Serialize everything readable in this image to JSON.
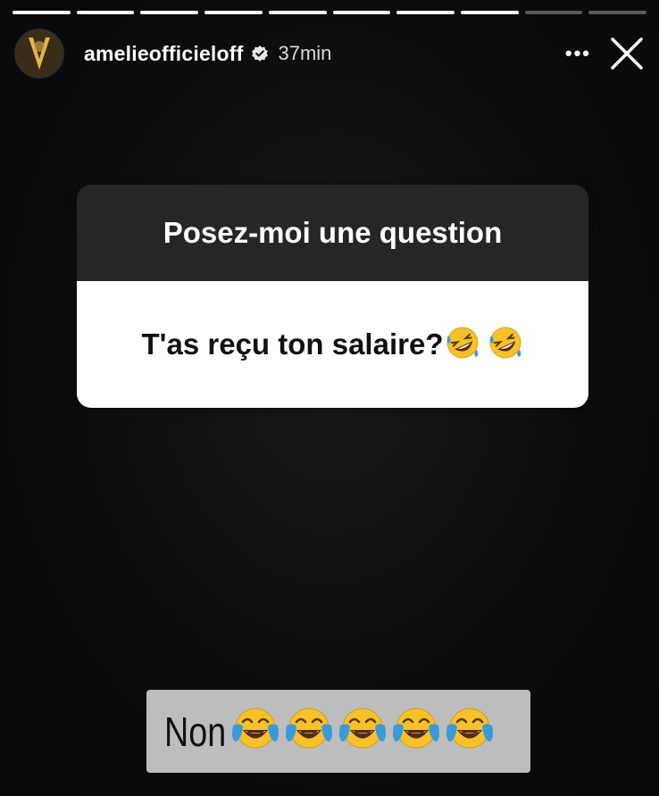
{
  "story": {
    "progress": {
      "segments_total": 10,
      "segments_viewed": 8
    },
    "header": {
      "username": "amelieofficieloff",
      "time": "37min",
      "verified_icon": "verified-badge-icon",
      "more_label": "•••",
      "close_icon": "close-icon"
    },
    "question_sticker": {
      "title": "Posez-moi une question",
      "question": "T'as reçu ton salaire?",
      "question_emojis": [
        "rolling-on-floor-laughing-emoji",
        "rolling-on-floor-laughing-emoji"
      ]
    },
    "answer": {
      "text": "Non",
      "emojis": [
        "tears-of-joy-emoji",
        "tears-of-joy-emoji",
        "tears-of-joy-emoji",
        "tears-of-joy-emoji",
        "tears-of-joy-emoji"
      ]
    },
    "colors": {
      "background": "#0b0b0b",
      "card_header": "#262626",
      "card_body": "#ffffff",
      "answer_bg": "#bdbdbd",
      "emoji_yellow": "#f6c12b",
      "emoji_tear": "#3a9ad9"
    }
  }
}
